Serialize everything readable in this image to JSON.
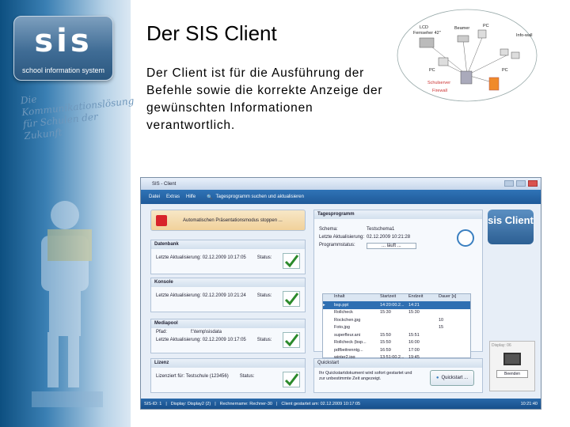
{
  "sidebar": {
    "logo_text": "sis",
    "logo_subtitle": "school information system",
    "tagline": "Die Kommunikationslösung für Schulen der Zukunft"
  },
  "slide": {
    "title": "Der SIS Client",
    "body": "Der Client ist für die Ausführung der Befehle sowie die korrekte Anzeige der gewünschten Informationen verantwortlich."
  },
  "diagram": {
    "lcd": "LCD",
    "fernseher": "Fernseher 42\"",
    "beamer": "Beamer",
    "pc1": "PC",
    "pc2": "PC",
    "pc3": "PC",
    "infowall": "Info-wall",
    "server": "Schulserver",
    "firewall": "Firewall"
  },
  "app": {
    "window_title": "SIS - Client",
    "menu": {
      "datei": "Datei",
      "extras": "Extras",
      "hilfe": "Hilfe",
      "search": "Tagesprogramm suchen und aktualisieren"
    },
    "stop_button": "Automatischen Präsentationsmodus stoppen ...",
    "datenbank": {
      "title": "Datenbank",
      "update_label": "Letzte Aktualisierung:",
      "update_value": "02.12.2009 10:17:05",
      "status": "Status:"
    },
    "konsole": {
      "title": "Konsole",
      "update_label": "Letzte Aktualisierung:",
      "update_value": "02.12.2009 10:21:24",
      "status": "Status:"
    },
    "mediapool": {
      "title": "Mediapool",
      "pfad_label": "Pfad:",
      "pfad_value": "f:\\temp\\sisdata",
      "update_label": "Letzte Aktualisierung:",
      "update_value": "02.12.2009 10:17:05",
      "status": "Status:"
    },
    "lizenz": {
      "title": "Lizenz",
      "label": "Lizenziert für:",
      "value": "Testschule (123456)",
      "status": "Status:"
    },
    "tagesprogramm": {
      "title": "Tagesprogramm",
      "schema_label": "Schema:",
      "schema_value": "Testschema1",
      "update_label": "Letzte Aktualisierung:",
      "update_value": "02.12.2009 10:21:28",
      "programm_label": "Programmstatus:",
      "programm_value": "... läuft ...",
      "columns": [
        "Inhalt",
        "Startzeit",
        "Endzeit",
        "Dauer [s]"
      ],
      "rows": [
        {
          "name": "bsp.ppt",
          "start": "14:20:00.2...",
          "end": "14:21",
          "dur": "",
          "sel": true
        },
        {
          "name": "Rollcheck",
          "start": "15:30",
          "end": "15:30",
          "dur": "",
          "sel": false
        },
        {
          "name": "Rockchen.jpg",
          "start": "",
          "end": "",
          "dur": "10",
          "sel": false
        },
        {
          "name": "Foto.jpg",
          "start": "",
          "end": "",
          "dur": "15",
          "sel": false
        },
        {
          "name": "superfleur.ani",
          "start": "15:50",
          "end": "15:51",
          "dur": "",
          "sel": false
        },
        {
          "name": "Rollcheck (bsp...",
          "start": "15:50",
          "end": "16:00",
          "dur": "",
          "sel": false
        },
        {
          "name": "pdfbeitrenntg...",
          "start": "16:59",
          "end": "17:00",
          "dur": "",
          "sel": false
        },
        {
          "name": "winter2.jpg",
          "start": "13:51:00.2...",
          "end": "19:45",
          "dur": "",
          "sel": false
        }
      ]
    },
    "quickstart": {
      "title": "Quickstart",
      "text": "Ihr Quickstartdokument wird sofort gestartet und zur unbestimmte Zeit angezeigt.",
      "button": "Quickstart ..."
    },
    "right": {
      "logo": "sis Client",
      "display_label": "Display: 06",
      "beenden": "Beenden"
    },
    "statusbar": {
      "sisid": "SIS-ID:  1",
      "display": "Display: Display2 (2)",
      "rechner": "Rechnername: Rechner-30",
      "started": "Client gestartet am:  02.12.2009 10:17:05",
      "time": "10:21:40"
    }
  }
}
